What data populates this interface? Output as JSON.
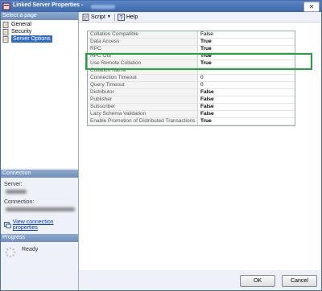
{
  "window": {
    "title": "Linked Server Properties -"
  },
  "sidebar": {
    "select_page_header": "Select a page",
    "pages": [
      {
        "label": "General",
        "selected": false
      },
      {
        "label": "Security",
        "selected": false
      },
      {
        "label": "Server Options",
        "selected": true
      }
    ],
    "connection_header": "Connection",
    "server_label": "Server:",
    "connection_label": "Connection:",
    "view_connection_link": "View connection properties",
    "progress_header": "Progress",
    "progress_status": "Ready"
  },
  "toolbar": {
    "script_label": "Script",
    "help_label": "Help"
  },
  "properties": [
    {
      "name": "Collation Compatible",
      "value": "False",
      "bold": false
    },
    {
      "name": "Data Access",
      "value": "True",
      "bold": true
    },
    {
      "name": "RPC",
      "value": "True",
      "bold": true
    },
    {
      "name": "RPC Out",
      "value": "True",
      "bold": true
    },
    {
      "name": "Use Remote Collation",
      "value": "True",
      "bold": true
    },
    {
      "name": "Collation Name",
      "value": "",
      "bold": false
    },
    {
      "name": "Connection Timeout",
      "value": "0",
      "bold": false
    },
    {
      "name": "Query Timeout",
      "value": "0",
      "bold": false
    },
    {
      "name": "Distributor",
      "value": "False",
      "bold": true
    },
    {
      "name": "Publisher",
      "value": "False",
      "bold": true
    },
    {
      "name": "Subscriber",
      "value": "False",
      "bold": true
    },
    {
      "name": "Lazy Schema Validation",
      "value": "False",
      "bold": true
    },
    {
      "name": "Enable Promotion of Distributed Transactions",
      "value": "True",
      "bold": true
    }
  ],
  "footer": {
    "ok_label": "OK",
    "cancel_label": "Cancel"
  },
  "colors": {
    "title_bar": "#3c67aa",
    "selection": "#316ac5",
    "highlight": "#22a23a",
    "link": "#0033cc"
  }
}
